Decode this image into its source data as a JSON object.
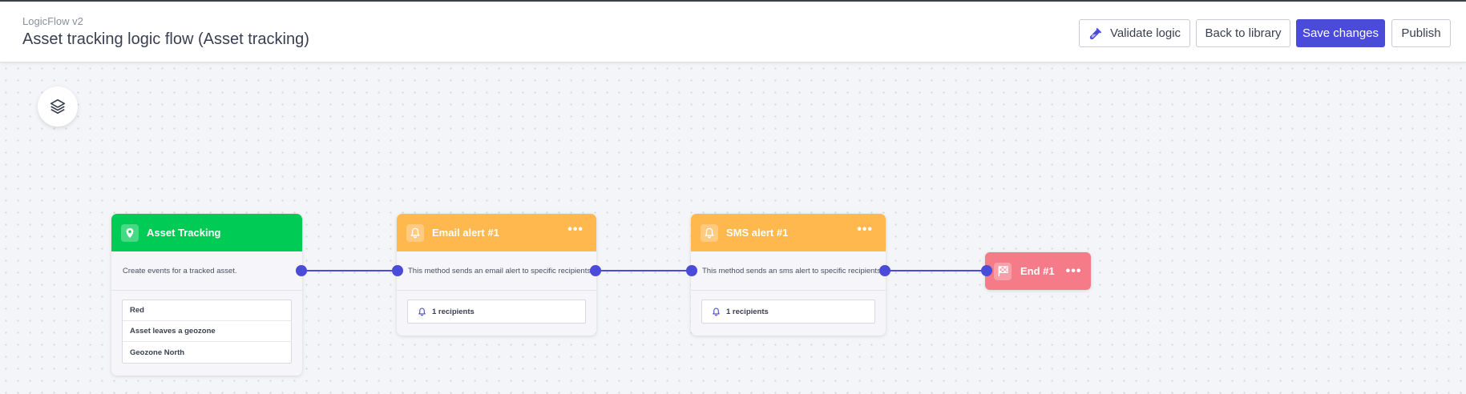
{
  "header": {
    "app_name": "LogicFlow v2",
    "title": "Asset tracking logic flow (Asset tracking)",
    "buttons": {
      "validate": "Validate logic",
      "back": "Back to library",
      "save": "Save changes",
      "publish": "Publish"
    }
  },
  "colors": {
    "accent": "#4a4bd8",
    "trigger": "#00cc55",
    "alert": "#ffb84d",
    "end": "#f47b87"
  },
  "icons": {
    "validate": "flask-icon",
    "layers": "layers-icon",
    "trigger": "location-pin-icon",
    "alert": "bell-icon",
    "end": "checkered-flag-icon"
  },
  "nodes": {
    "asset_tracking": {
      "title": "Asset Tracking",
      "description": "Create events for a tracked asset.",
      "conditions": [
        "Red",
        "Asset leaves a geozone",
        "Geozone North"
      ]
    },
    "email_alert": {
      "title": "Email alert #1",
      "description": "This method sends an email alert to specific recipients",
      "recipients": "1 recipients"
    },
    "sms_alert": {
      "title": "SMS alert #1",
      "description": "This method sends an sms alert to specific recipients",
      "recipients": "1 recipients"
    },
    "end": {
      "title": "End #1"
    }
  },
  "more_glyph": "•••"
}
